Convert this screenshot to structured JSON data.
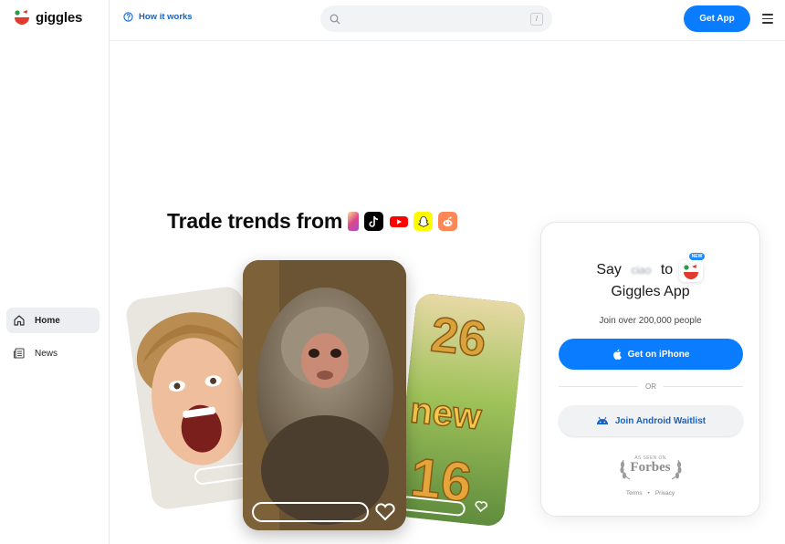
{
  "brand": {
    "name": "giggles"
  },
  "header": {
    "how_it_works": "How it works",
    "search_placeholder": "",
    "search_shortcut": "/",
    "get_app": "Get App"
  },
  "sidebar": {
    "items": [
      {
        "label": "Home",
        "icon": "home-icon",
        "active": true
      },
      {
        "label": "News",
        "icon": "news-icon",
        "active": false
      }
    ]
  },
  "hero": {
    "title": "Trade trends from",
    "platforms": [
      "instagram-icon",
      "tiktok-icon",
      "youtube-icon",
      "snapchat-icon",
      "reddit-icon"
    ]
  },
  "cards": [
    {
      "subject": "laughing child"
    },
    {
      "subject": "monkey"
    },
    {
      "subject": "2026 new year poster",
      "text": "26 new 16"
    }
  ],
  "panel": {
    "say": "Say",
    "word": "ciao",
    "to": "to",
    "badge": "NEW",
    "app_name": "Giggles App",
    "join": "Join over 200,000 people",
    "iphone": "Get on iPhone",
    "or": "OR",
    "android": "Join Android Waitlist",
    "as_seen": "AS SEEN ON",
    "forbes": "Forbes",
    "terms": "Terms",
    "dot": "•",
    "privacy": "Privacy"
  },
  "colors": {
    "accent": "#0a7cff",
    "link": "#1363c6"
  }
}
